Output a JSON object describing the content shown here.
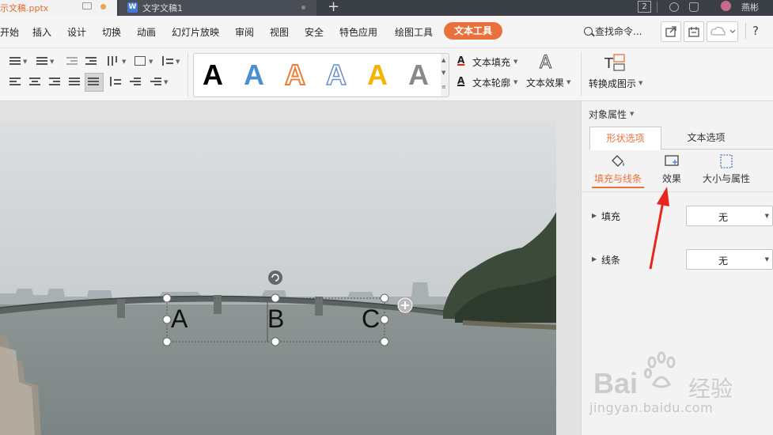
{
  "titlebar": {
    "tabs": [
      {
        "title": "示文稿.pptx",
        "active": true
      },
      {
        "title": "文字文稿1",
        "active": false
      }
    ],
    "new_tab": "+",
    "badge": "2",
    "user": "燕彬"
  },
  "menu": {
    "items": [
      "开始",
      "插入",
      "设计",
      "切换",
      "动画",
      "幻灯片放映",
      "审阅",
      "视图",
      "安全",
      "特色应用",
      "绘图工具"
    ],
    "active_tab": "文本工具",
    "search": "查找命令...",
    "help": "?"
  },
  "ribbon": {
    "style_gallery": [
      "A",
      "A",
      "A",
      "A",
      "A",
      "A"
    ],
    "text_fill": "文本填充",
    "text_outline": "文本轮廓",
    "text_effect": "文本效果",
    "text_effect_icon": "A",
    "convert": "转换成图示"
  },
  "slide": {
    "textbox_letters": [
      "A",
      "B",
      "C"
    ]
  },
  "pane": {
    "title": "对象属性",
    "tabs": [
      "形状选项",
      "文本选项"
    ],
    "subtabs": [
      "填充与线条",
      "效果",
      "大小与属性"
    ],
    "props": [
      {
        "label": "填充",
        "value": "无"
      },
      {
        "label": "线条",
        "value": "无"
      }
    ]
  },
  "watermark": {
    "brand": "Bai",
    "brand_suffix": "经验",
    "url": "jingyan.baidu.com"
  },
  "colors": {
    "accent": "#e9713b",
    "titlebar": "#3b3f46",
    "annotation_arrow": "#e8261e"
  }
}
